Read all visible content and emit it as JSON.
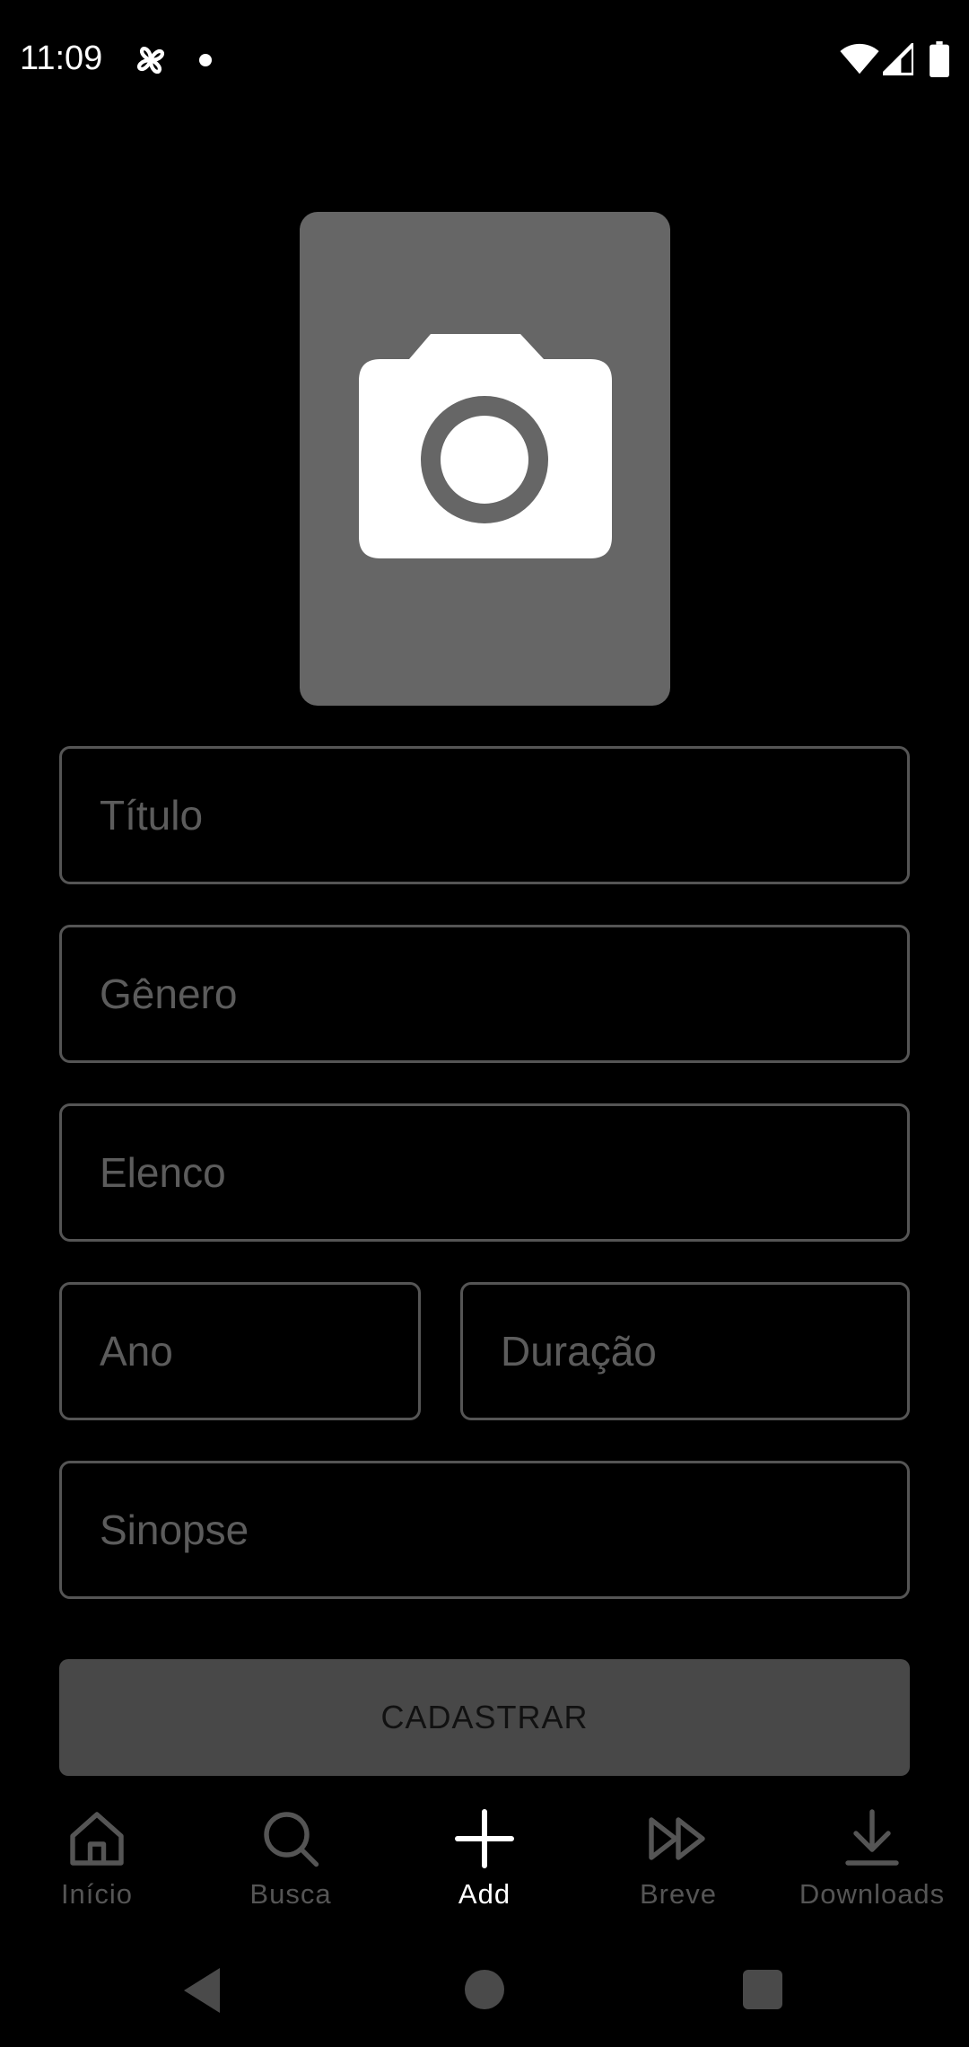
{
  "status_bar": {
    "time": "11:09",
    "icons": [
      "pinwheel-icon",
      "notification-dot-icon",
      "wifi-icon",
      "signal-icon",
      "battery-icon"
    ]
  },
  "photo_picker": {
    "icon": "camera-icon"
  },
  "form": {
    "titulo_placeholder": "Título",
    "genero_placeholder": "Gênero",
    "elenco_placeholder": "Elenco",
    "ano_placeholder": "Ano",
    "duracao_placeholder": "Duração",
    "sinopse_placeholder": "Sinopse",
    "submit_label": "CADASTRAR"
  },
  "bottom_nav": {
    "items": [
      {
        "label": "Início",
        "icon": "home-icon",
        "active": false
      },
      {
        "label": "Busca",
        "icon": "search-icon",
        "active": false
      },
      {
        "label": "Add",
        "icon": "plus-icon",
        "active": true
      },
      {
        "label": "Breve",
        "icon": "fast-forward-icon",
        "active": false
      },
      {
        "label": "Downloads",
        "icon": "download-icon",
        "active": false
      }
    ]
  },
  "colors": {
    "background": "#000000",
    "photo_placeholder": "#666666",
    "field_border": "#555555",
    "placeholder_text": "#5c5c5c",
    "button_bg": "#484848",
    "nav_inactive": "#555555",
    "nav_active": "#ffffff"
  }
}
